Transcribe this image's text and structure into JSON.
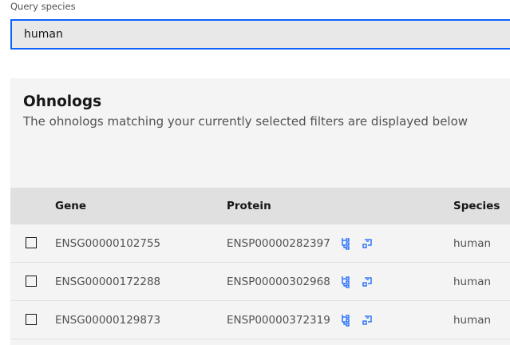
{
  "query": {
    "label": "Query species",
    "value": "human"
  },
  "panel": {
    "title": "Ohnologs",
    "description": "The ohnologs matching your currently selected filters are displayed below"
  },
  "table": {
    "headers": {
      "gene": "Gene",
      "protein": "Protein",
      "species": "Species"
    },
    "rows": [
      {
        "gene": "ENSG00000102755",
        "protein": "ENSP00000282397",
        "species": "human"
      },
      {
        "gene": "ENSG00000172288",
        "protein": "ENSP00000302968",
        "species": "human"
      },
      {
        "gene": "ENSG00000129873",
        "protein": "ENSP00000372319",
        "species": "human"
      }
    ]
  },
  "colors": {
    "accent": "#0f62fe",
    "panel_bg": "#f4f4f4",
    "header_bg": "#e0e0e0"
  },
  "icons": {
    "tree": "tree-view-icon",
    "launch": "launch-icon"
  }
}
